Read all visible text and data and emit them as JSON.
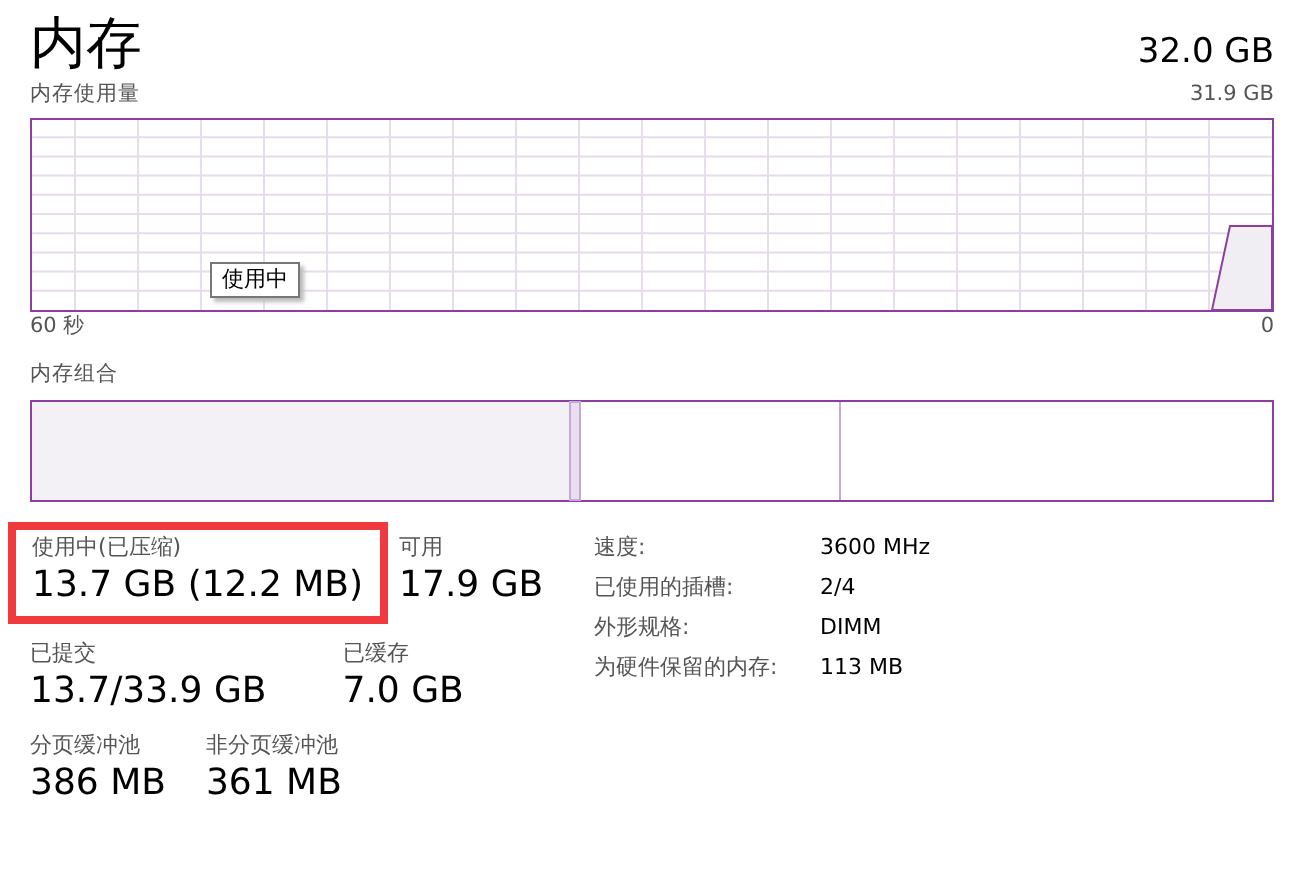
{
  "header": {
    "title": "内存",
    "total": "32.0 GB"
  },
  "usage_graph": {
    "label": "内存使用量",
    "max": "31.9 GB",
    "tooltip": "使用中",
    "x_start": "60 秒",
    "x_end": "0"
  },
  "composition": {
    "label": "内存组合"
  },
  "stat_rows": [
    [
      {
        "label": "使用中(已压缩)",
        "value": "13.7 GB (12.2 MB)",
        "highlighted": true
      },
      {
        "label": "可用",
        "value": "17.9 GB",
        "highlighted": false
      }
    ],
    [
      {
        "label": "已提交",
        "value": "13.7/33.9 GB",
        "highlighted": false
      },
      {
        "label": "已缓存",
        "value": "7.0 GB",
        "highlighted": false
      }
    ],
    [
      {
        "label": "分页缓冲池",
        "value": "386 MB",
        "highlighted": false
      },
      {
        "label": "非分页缓冲池",
        "value": "361 MB",
        "highlighted": false
      }
    ]
  ],
  "details": [
    {
      "label": "速度:",
      "value": "3600 MHz"
    },
    {
      "label": "已使用的插槽:",
      "value": "2/4"
    },
    {
      "label": "外形规格:",
      "value": "DIMM"
    },
    {
      "label": "为硬件保留的内存:",
      "value": "113 MB"
    }
  ]
}
